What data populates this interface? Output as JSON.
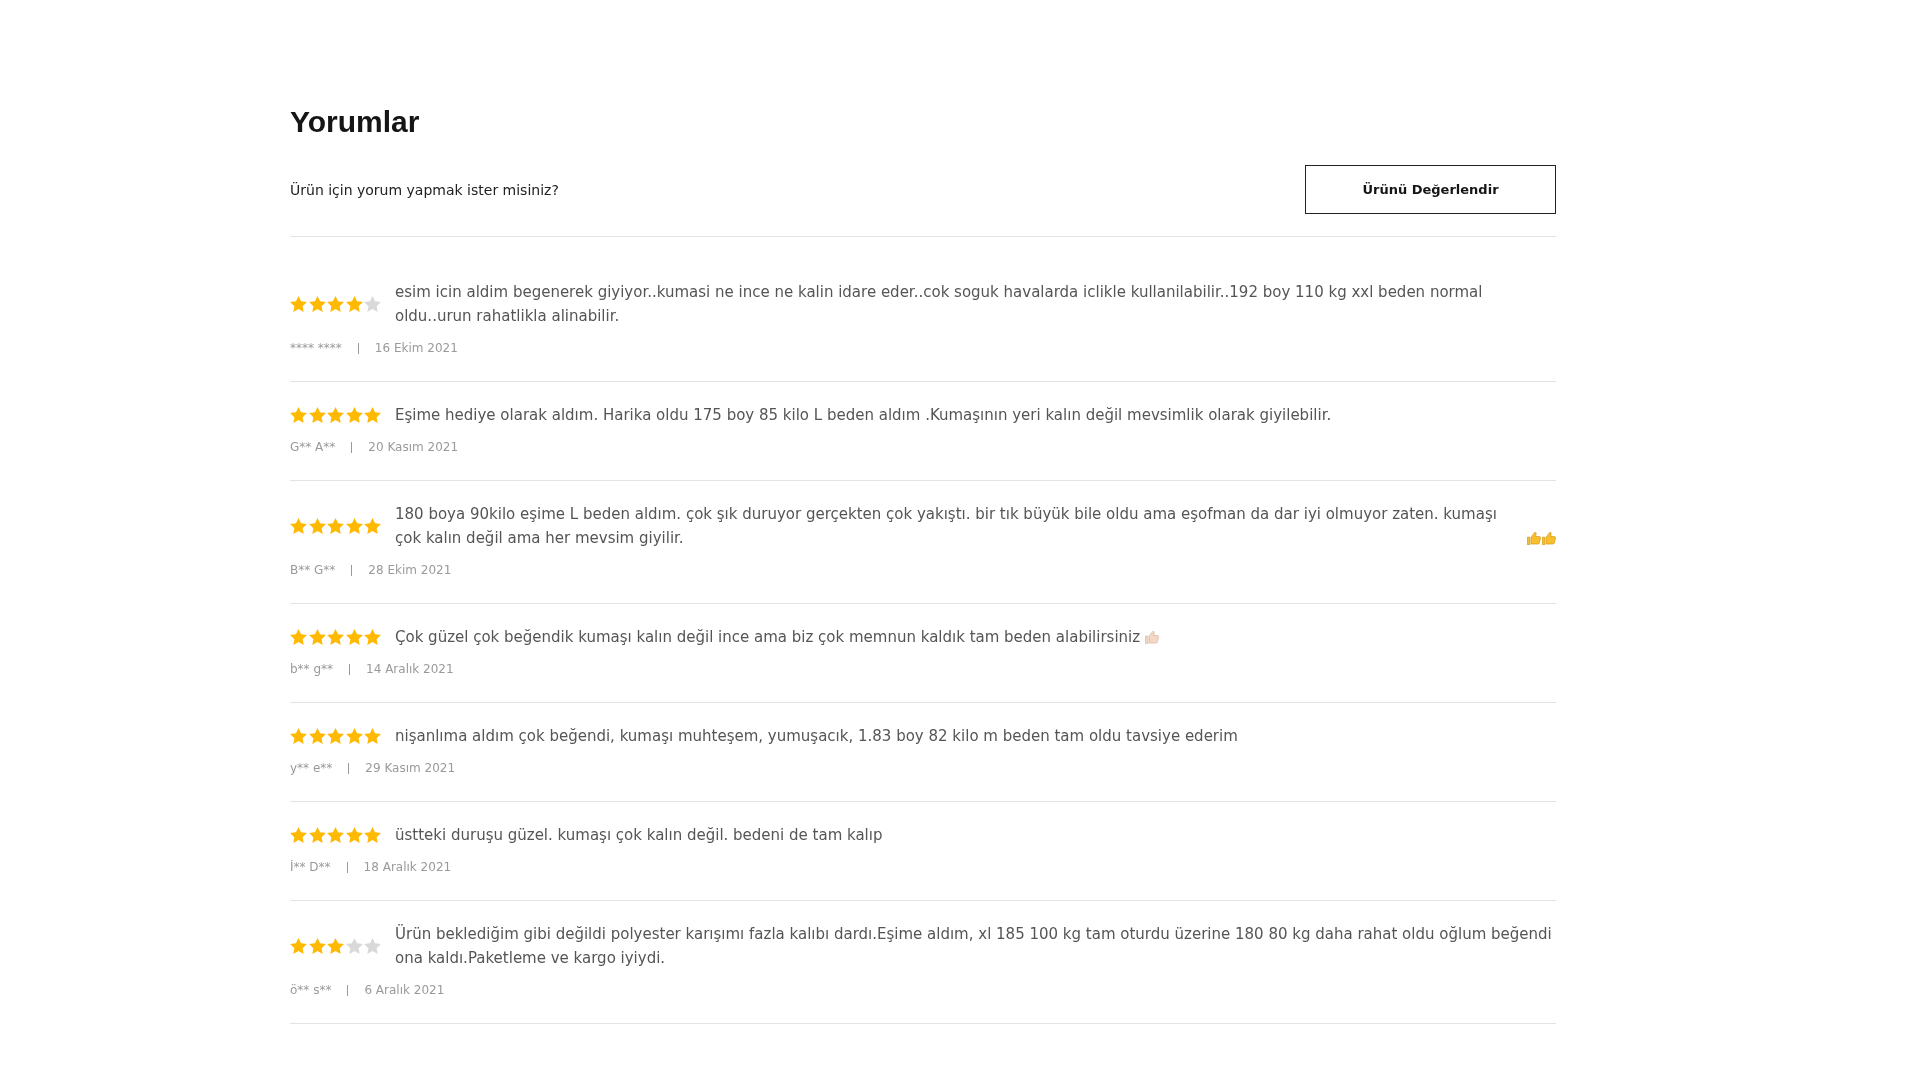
{
  "title": "Yorumlar",
  "prompt": {
    "text": "Ürün için yorum yapmak ister misiniz?",
    "button": "Ürünü Değerlendir"
  },
  "reviews": [
    {
      "stars": 4,
      "text": "esim icin aldim begenerek giyiyor..kumasi ne ince ne kalin idare eder..cok soguk havalarda iclikle kullanilabilir..192 boy 110 kg xxl beden normal oldu..urun rahatlikla alinabilir.",
      "author": "**** ****",
      "date": "16 Ekim 2021"
    },
    {
      "stars": 5,
      "text": "Eşime hediye olarak aldım. Harika oldu 175 boy 85 kilo L beden aldım .Kumaşının yeri kalın değil mevsimlik olarak giyilebilir.",
      "author": "G** A**",
      "date": "20 Kasım 2021"
    },
    {
      "stars": 5,
      "text": "180 boya 90kilo eşime L beden aldım. çok şık duruyor gerçekten çok yakıştı. bir tık büyük bile oldu ama eşofman da dar iyi olmuyor zaten. kumaşı çok kalın değil ama her mevsim giyilir.",
      "emojis": [
        {
          "kind": "thumbs-up"
        },
        {
          "kind": "thumbs-up"
        }
      ],
      "author": "B** G**",
      "date": "28 Ekim 2021"
    },
    {
      "stars": 5,
      "text": "Çok güzel çok beğendik kumaşı kalın değil ince ama biz çok memnun kaldık tam beden alabilirsiniz",
      "emojis": [
        {
          "kind": "thumbs-up-light-skin"
        }
      ],
      "author": "b** g**",
      "date": "14 Aralık 2021"
    },
    {
      "stars": 5,
      "text": "nişanlıma aldım çok beğendi, kumaşı muhteşem, yumuşacık, 1.83 boy 82 kilo m beden tam oldu tavsiye ederim",
      "author": "y** e**",
      "date": "29 Kasım 2021"
    },
    {
      "stars": 5,
      "text": "üstteki duruşu güzel. kumaşı çok kalın değil. bedeni de tam kalıp",
      "author": "İ** D**",
      "date": "18 Aralık 2021"
    },
    {
      "stars": 3,
      "text": "Ürün beklediğim gibi değildi polyester karışımı fazla kalıbı dardı.Eşime aldım, xl 185 100 kg tam oturdu üzerine 180 80 kg daha rahat oldu oğlum beğendi ona kaldı.Paketleme ve kargo iyiydi.",
      "author": "ö** s**",
      "date": "6 Aralık 2021"
    }
  ]
}
